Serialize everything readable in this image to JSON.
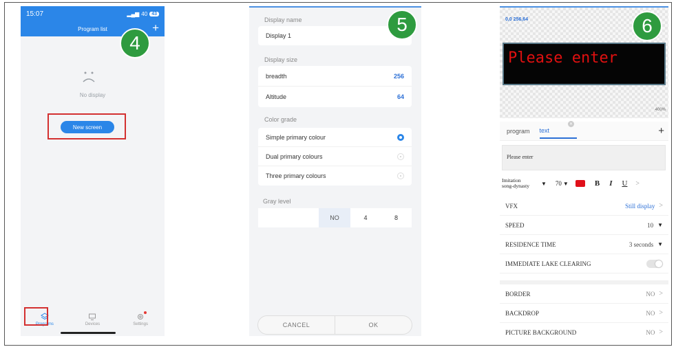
{
  "badges": {
    "p4": "4",
    "p5": "5",
    "p6": "6"
  },
  "colors": {
    "accent": "#2b86e8",
    "badge_green": "#2e9b3f",
    "highlight_red": "#d32f2f",
    "led_text": "#e01010"
  },
  "p4": {
    "status": {
      "time": "15:07",
      "network": "40",
      "battery": "43"
    },
    "title": "Program list",
    "add_label": "+",
    "empty_text": "No display",
    "new_button": "New screen",
    "tabs": [
      {
        "label": "Programs",
        "icon": "layers-icon",
        "active": true
      },
      {
        "label": "Devices",
        "icon": "monitor-icon",
        "active": false
      },
      {
        "label": "Settings",
        "icon": "gear-icon",
        "active": false
      }
    ]
  },
  "p5": {
    "display_name": {
      "label": "Display name",
      "value": "Display 1"
    },
    "display_size": {
      "label": "Display size",
      "breadth": {
        "label": "breadth",
        "value": "256"
      },
      "altitude": {
        "label": "Altitude",
        "value": "64"
      }
    },
    "color_grade": {
      "label": "Color grade",
      "options": [
        {
          "label": "Simple primary colour",
          "selected": true
        },
        {
          "label": "Dual primary colours",
          "selected": false
        },
        {
          "label": "Three primary colours",
          "selected": false
        }
      ]
    },
    "gray_level": {
      "label": "Gray level",
      "options": [
        "NO",
        "4",
        "8"
      ],
      "selected": "NO"
    },
    "footer": {
      "cancel": "CANCEL",
      "ok": "OK"
    }
  },
  "p6": {
    "coord": "0,0 256,64",
    "led_text": "Please enter",
    "zoom": "400%",
    "tabs": {
      "program": "program",
      "text": "text",
      "add": "+"
    },
    "text_value": "Please enter",
    "format": {
      "font_line1": "Imitation",
      "font_line2": "song-dynasty",
      "size": "70",
      "bold": "B",
      "italic": "I",
      "underline": "U"
    },
    "settings": [
      {
        "label": "VFX",
        "value": "Still display"
      },
      {
        "label": "SPEED",
        "value": "10"
      },
      {
        "label": "RESIDENCE TIME",
        "value": "3 seconds"
      },
      {
        "label": "IMMEDIATE LAKE CLEARING"
      }
    ],
    "extras": [
      {
        "label": "BORDER",
        "value": "NO"
      },
      {
        "label": "BACKDROP",
        "value": "NO"
      },
      {
        "label": "PICTURE BACKGROUND",
        "value": "NO"
      }
    ]
  }
}
